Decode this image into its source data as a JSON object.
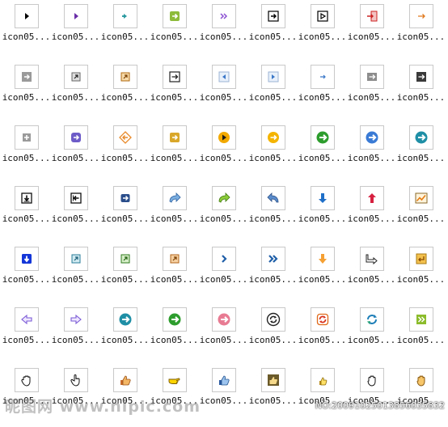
{
  "caption": "icon05...",
  "rows": [
    [
      "tri-right-black",
      "tri-right-purple",
      "tri-right-teal",
      "arrow-right-green-square",
      "double-chevron-purple",
      "arrow-right-black-square",
      "play-outline-square",
      "exit-door-red",
      "arrow-right-orange-small"
    ],
    [
      "arrow-right-gray-square",
      "arrow-diag-gray",
      "arrow-diag-orange-square",
      "arrow-right-black-box",
      "tri-left-blue-box",
      "tri-right-blue-box",
      "arrow-right-blue-small",
      "arrow-right-gray-box",
      "arrow-right-dark-box"
    ],
    [
      "plus-gray-square",
      "arrow-right-purple-square",
      "arrow-left-orange-diamond",
      "arrow-right-yellow-square",
      "play-orange-circle",
      "arrow-right-orange-circle",
      "arrow-right-green-circle",
      "arrow-right-blue-circle",
      "arrow-right-teal-circle"
    ],
    [
      "arrow-down-black-box",
      "arrow-left-black-box",
      "arrow-right-navy-box",
      "arrow-curve-blue",
      "arrow-curve-green",
      "arrow-undo-blue",
      "arrow-down-blue",
      "arrow-up-red",
      "chart-trend-orange"
    ],
    [
      "arrow-down-blue-box",
      "arrow-diag-teal-square",
      "arrow-diag-green-square",
      "arrow-diag-orange-box",
      "chevron-right-blue",
      "double-chevron-blue",
      "arrow-down-orange",
      "arrow-bent-outline",
      "arrow-return-orange-box"
    ],
    [
      "arrow-left-purple-outline",
      "arrow-right-purple-outline",
      "arrow-right-teal-circle",
      "arrow-right-green-circle",
      "arrow-right-pink-circle",
      "refresh-black-circle",
      "refresh-orange-red",
      "refresh-blue-teal",
      "double-chevron-green-box"
    ],
    [
      "hand-grab-outline",
      "hand-pointer-outline",
      "thumbs-up-orange",
      "hand-point-yellow",
      "thumbs-up-blue",
      "thumbs-up-tan-box",
      "thumbs-up-yellow-small",
      "hand-stop-outline",
      "hand-stop-orange"
    ]
  ],
  "watermark": {
    "left": "昵图网 www.nipic.com",
    "right": "NO:20091025013856035832"
  }
}
